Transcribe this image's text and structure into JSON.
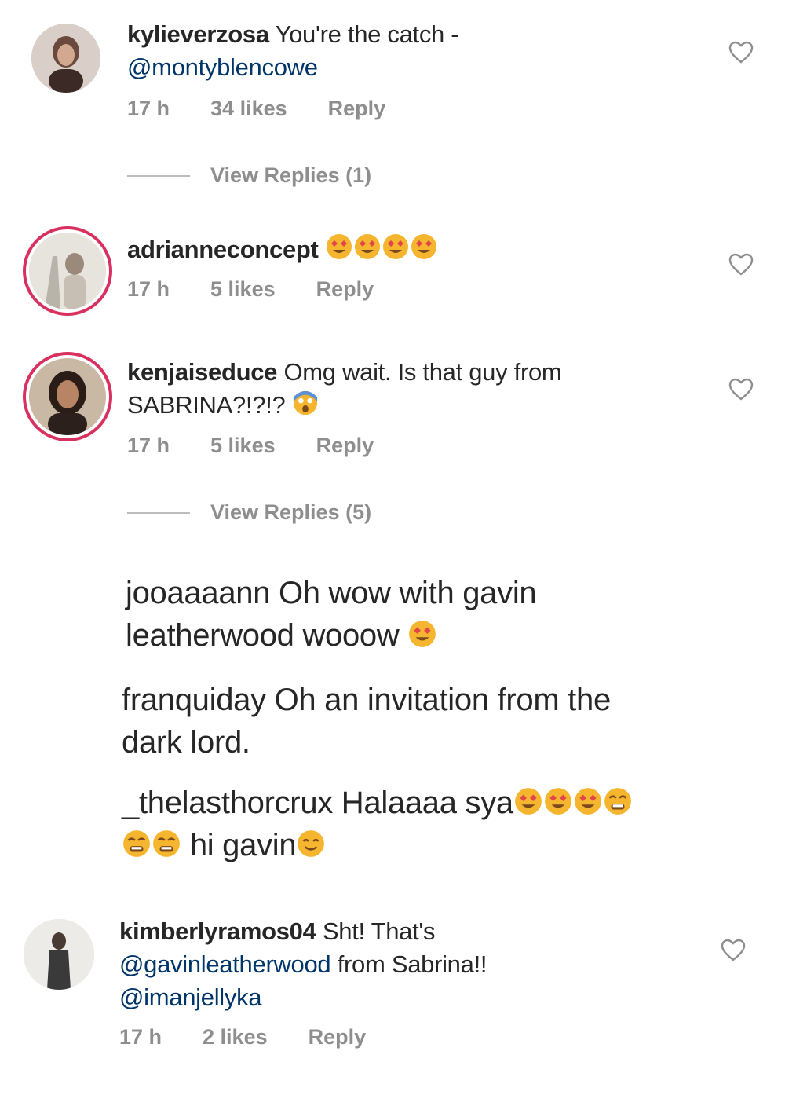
{
  "comments": [
    {
      "username": "kylieverzosa",
      "text": "You're the catch -",
      "mention": "@montyblencowe",
      "time": "17 h",
      "likes": "34 likes",
      "reply": "Reply",
      "view_replies": "View Replies (1)"
    },
    {
      "username": "adrianneconcept",
      "emoji": "😍😍😍😍",
      "time": "17 h",
      "likes": "5 likes",
      "reply": "Reply"
    },
    {
      "username": "kenjaiseduce",
      "text_line1": "Omg wait. Is that guy from",
      "text_line2": "SABRINA?!?!?",
      "emoji": "😱",
      "time": "17 h",
      "likes": "5 likes",
      "reply": "Reply",
      "view_replies": "View Replies (5)"
    },
    {
      "username": "kimberlyramos04",
      "text": "Sht! That's",
      "mention1": "@gavinleatherwood",
      "text2": "from Sabrina!!",
      "mention2": "@imanjellyka",
      "time": "17 h",
      "likes": "2 likes",
      "reply": "Reply"
    }
  ],
  "replies": [
    {
      "line1": "jooaaaann Oh wow with gavin",
      "line2": "leatherwood wooow"
    },
    {
      "line1": "franquiday Oh an invitation from the",
      "line2": "dark lord."
    },
    {
      "line1": "_thelasthorcrux Halaaaa sya",
      "line2": "hi gavin"
    }
  ],
  "colors": {
    "text": "#262626",
    "meta": "#8e8e8e",
    "mention": "#003569",
    "story_ring": "#d9315f"
  },
  "icons": [
    "heart-icon",
    "heart-eyes-emoji",
    "screaming-emoji",
    "crying-emoji",
    "smiling-emoji"
  ]
}
